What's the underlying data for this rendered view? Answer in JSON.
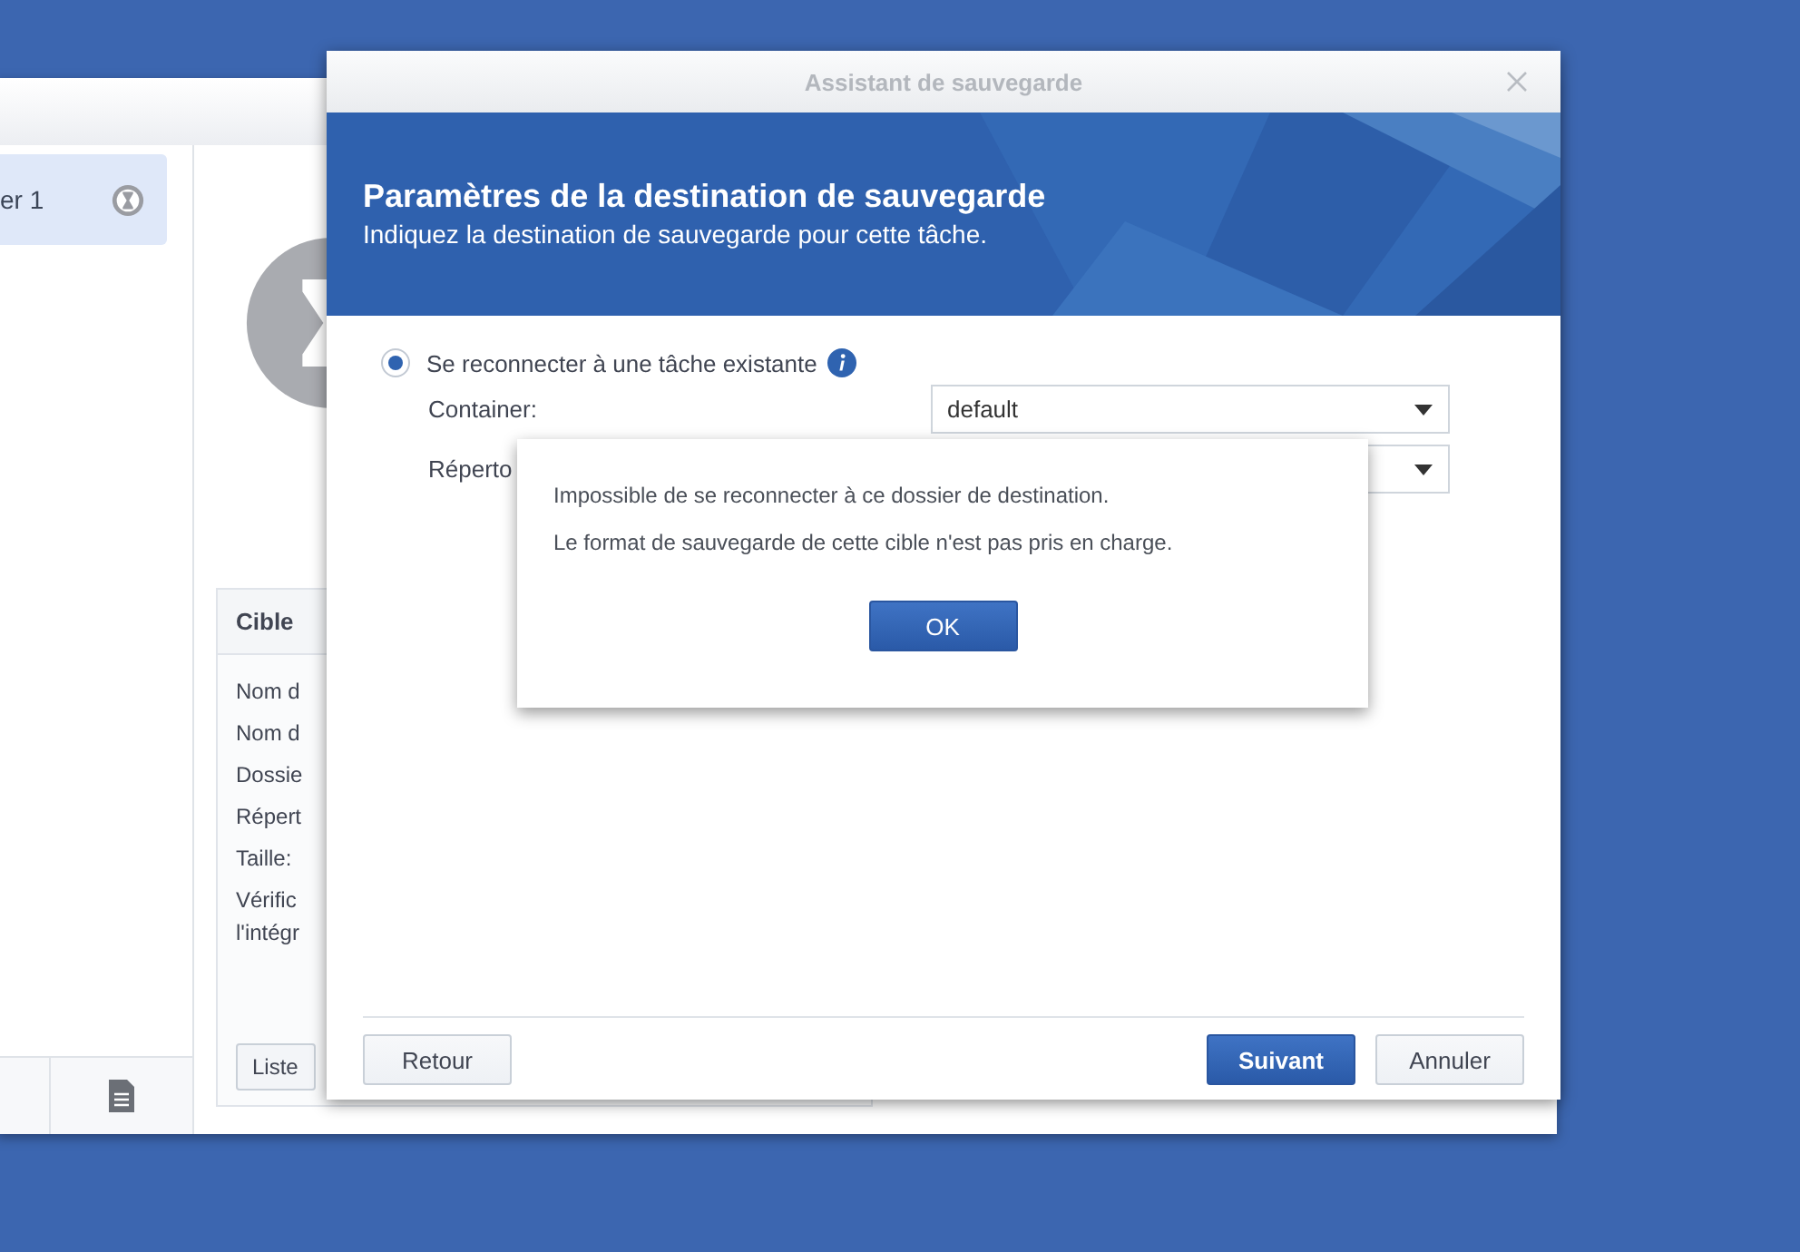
{
  "back_window": {
    "sidebar": {
      "items": [
        {
          "label": "er 1",
          "selected": true
        }
      ]
    },
    "card": {
      "title": "Cible",
      "rows": [
        "Nom d",
        "Nom d",
        "Dossie",
        "Répert",
        "Taille:",
        "Vérific\nl'intégr"
      ],
      "button": "Liste"
    }
  },
  "wizard": {
    "title": "Assistant de sauvegarde",
    "heading": "Paramètres de la destination de sauvegarde",
    "subheading": "Indiquez la destination de sauvegarde pour cette tâche.",
    "option": {
      "label": "Se reconnecter à une tâche existante",
      "selected": true
    },
    "fields": [
      {
        "label": "Container:",
        "value": "default"
      },
      {
        "label": "Réperto"
      }
    ],
    "buttons": [
      {
        "label": "Retour",
        "kind": "secondary"
      },
      {
        "label": "Suivant",
        "kind": "primary"
      },
      {
        "label": "Annuler",
        "kind": "secondary"
      }
    ]
  },
  "alert": {
    "lines": [
      "Impossible de se reconnecter à ce dossier de destination.",
      "Le format de sauvegarde de cette cible n'est pas pris en charge."
    ],
    "button": "OK"
  }
}
